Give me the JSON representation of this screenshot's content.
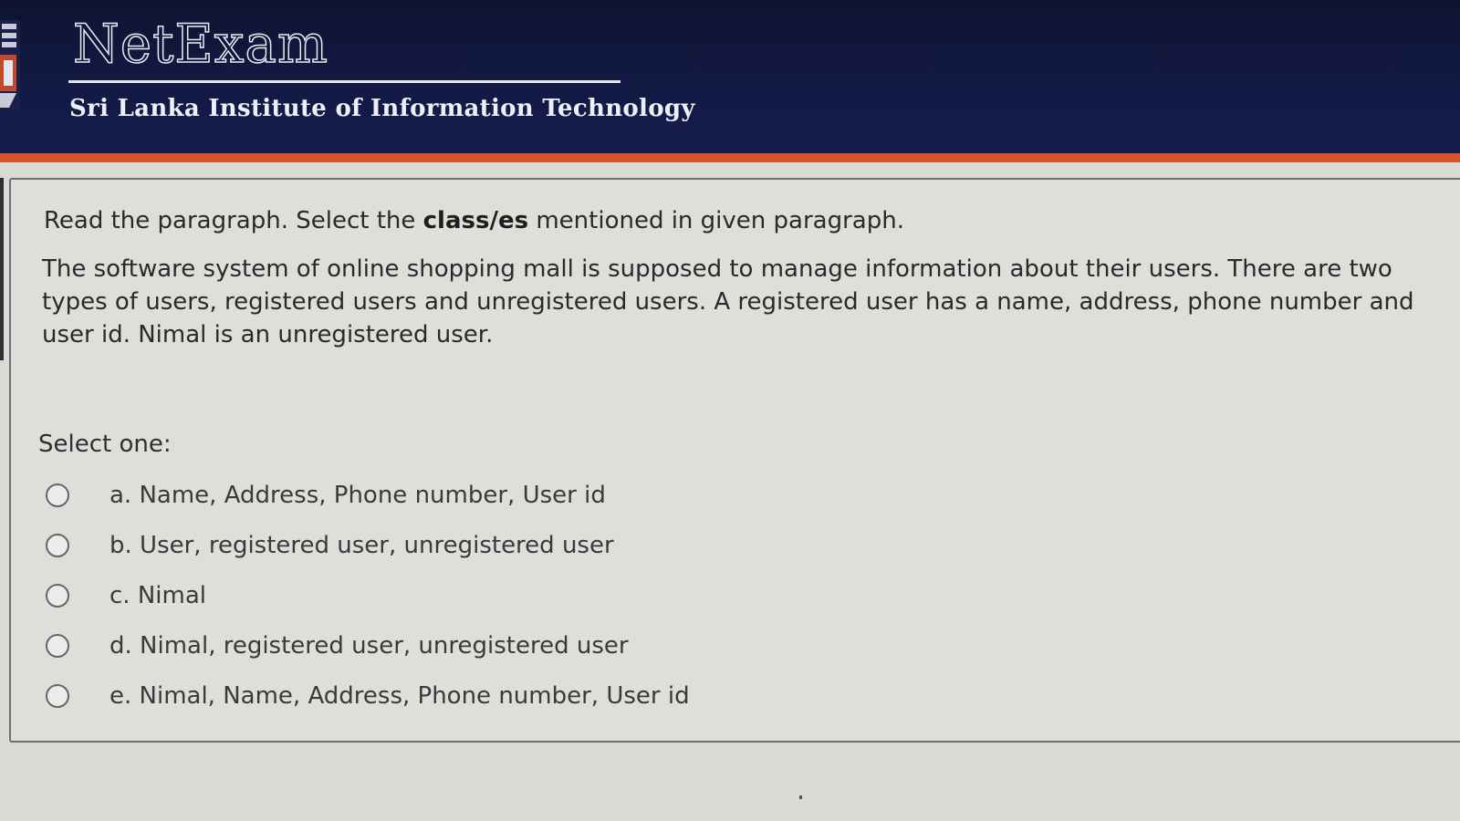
{
  "header": {
    "brand": "NetExam",
    "institute": "Sri Lanka Institute of Information Technology"
  },
  "question": {
    "instruction_before": "Read the paragraph. Select the ",
    "instruction_bold": "class/es",
    "instruction_after": " mentioned in given paragraph.",
    "paragraph": "The software system of online shopping mall is supposed to manage information about their users. There are two types of users, registered users and unregistered users. A registered user has a name, address, phone number and user id. Nimal is an unregistered user.",
    "prompt": "Select one:",
    "options": [
      {
        "label": "a. Name, Address, Phone number, User id"
      },
      {
        "label": "b. User, registered user, unregistered user"
      },
      {
        "label": "c. Nimal"
      },
      {
        "label": "d. Nimal, registered user, unregistered user"
      },
      {
        "label": "e. Nimal, Name, Address, Phone number, User id"
      }
    ]
  },
  "colors": {
    "header_bg": "#131a45",
    "header_accent": "#d9542b",
    "panel_bg": "#dedfdb"
  }
}
